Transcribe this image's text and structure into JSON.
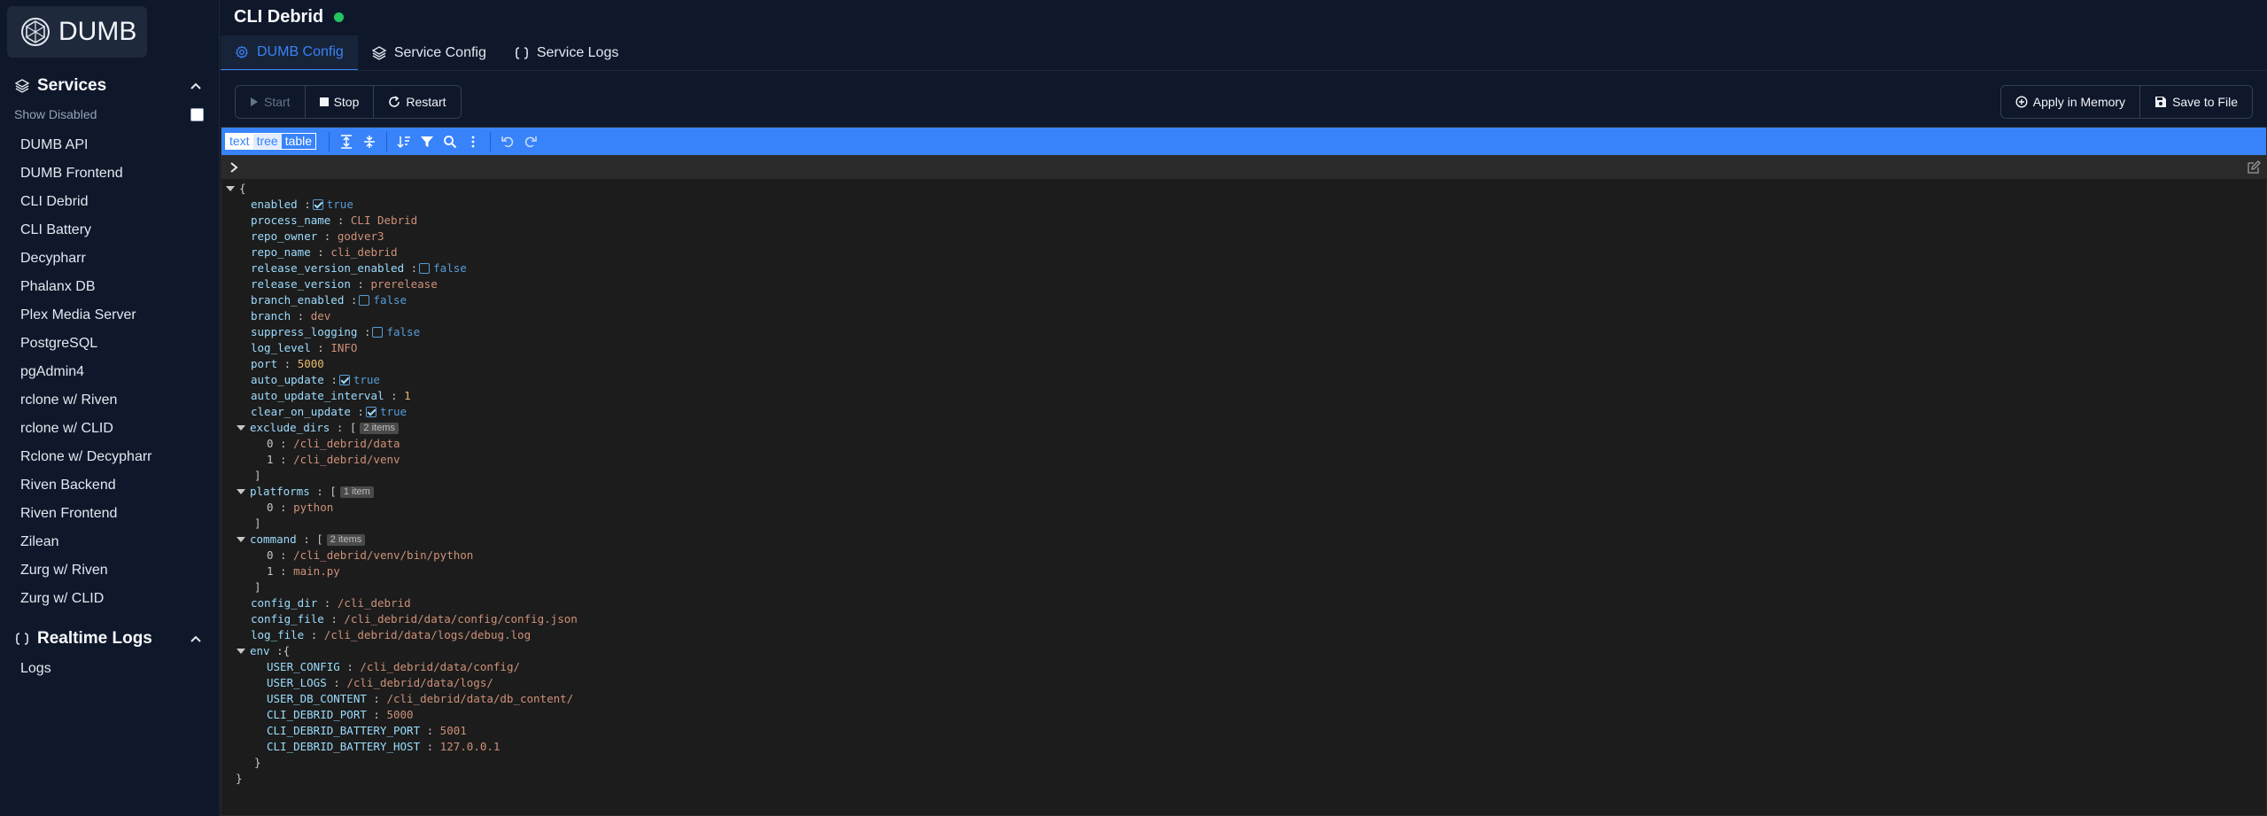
{
  "app": {
    "logo_text": "DUMB"
  },
  "sidebar": {
    "services_title": "Services",
    "show_disabled_label": "Show Disabled",
    "services": [
      "DUMB API",
      "DUMB Frontend",
      "CLI Debrid",
      "CLI Battery",
      "Decypharr",
      "Phalanx DB",
      "Plex Media Server",
      "PostgreSQL",
      "pgAdmin4",
      "rclone w/ Riven",
      "rclone w/ CLID",
      "Rclone w/ Decypharr",
      "Riven Backend",
      "Riven Frontend",
      "Zilean",
      "Zurg w/ Riven",
      "Zurg w/ CLID"
    ],
    "realtime_title": "Realtime Logs",
    "logs_label": "Logs"
  },
  "header": {
    "title": "CLI Debrid",
    "status_color": "#22c55e"
  },
  "tabs": [
    "DUMB Config",
    "Service Config",
    "Service Logs"
  ],
  "actions": {
    "start": "Start",
    "stop": "Stop",
    "restart": "Restart",
    "apply": "Apply in Memory",
    "save": "Save to File"
  },
  "editor": {
    "modes": [
      "text",
      "tree",
      "table"
    ],
    "config": {
      "enabled": true,
      "process_name": "CLI Debrid",
      "repo_owner": "godver3",
      "repo_name": "cli_debrid",
      "release_version_enabled": false,
      "release_version": "prerelease",
      "branch_enabled": false,
      "branch": "dev",
      "suppress_logging": false,
      "log_level": "INFO",
      "port": 5000,
      "auto_update": true,
      "auto_update_interval": 1,
      "clear_on_update": true,
      "exclude_dirs": [
        "/cli_debrid/data",
        "/cli_debrid/venv"
      ],
      "platforms": [
        "python"
      ],
      "command": [
        "/cli_debrid/venv/bin/python",
        "main.py"
      ],
      "config_dir": "/cli_debrid",
      "config_file": "/cli_debrid/data/config/config.json",
      "log_file": "/cli_debrid/data/logs/debug.log",
      "env": {
        "USER_CONFIG": "/cli_debrid/data/config/",
        "USER_LOGS": "/cli_debrid/data/logs/",
        "USER_DB_CONTENT": "/cli_debrid/data/db_content/",
        "CLI_DEBRID_PORT": "5000",
        "CLI_DEBRID_BATTERY_PORT": "5001",
        "CLI_DEBRID_BATTERY_HOST": "127.0.0.1"
      }
    },
    "array_counts": {
      "exclude_dirs": "2 items",
      "platforms": "1 item",
      "command": "2 items"
    }
  },
  "colors": {
    "accent": "#3b82f6",
    "toolbar": "#3883fa",
    "background": "#0f172a"
  }
}
